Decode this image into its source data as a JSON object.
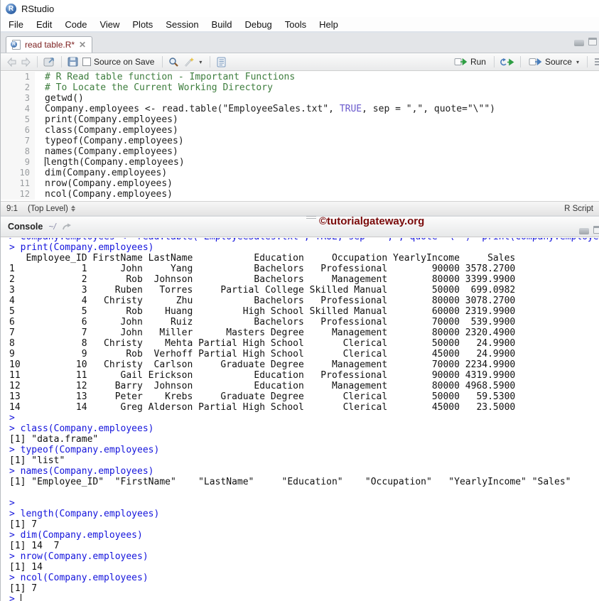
{
  "window": {
    "title": "RStudio"
  },
  "menu": [
    "File",
    "Edit",
    "Code",
    "View",
    "Plots",
    "Session",
    "Build",
    "Debug",
    "Tools",
    "Help"
  ],
  "editor": {
    "tab_label": "read table.R*",
    "toolbar": {
      "source_on_save": "Source on Save",
      "run": "Run",
      "source": "Source"
    },
    "status": {
      "cursor_position": "9:1",
      "scope": "(Top Level)",
      "file_type": "R Script"
    },
    "lines": [
      {
        "n": "1",
        "segs": [
          [
            "comment",
            "# R Read table function - Important Functions"
          ]
        ]
      },
      {
        "n": "2",
        "segs": [
          [
            "comment",
            "# To Locate the Current Working Directory"
          ]
        ]
      },
      {
        "n": "3",
        "segs": [
          [
            "code",
            "getwd()"
          ]
        ]
      },
      {
        "n": "4",
        "segs": [
          [
            "code",
            "Company.employees <- read.table(\"EmployeeSales.txt\", "
          ],
          [
            "keyword",
            "TRUE"
          ],
          [
            "code",
            ", sep = \",\", quote=\"\\\"\")"
          ]
        ]
      },
      {
        "n": "5",
        "segs": [
          [
            "code",
            "print(Company.employees)"
          ]
        ]
      },
      {
        "n": "6",
        "segs": [
          [
            "code",
            "class(Company.employees)"
          ]
        ]
      },
      {
        "n": "7",
        "segs": [
          [
            "code",
            "typeof(Company.employees)"
          ]
        ]
      },
      {
        "n": "8",
        "segs": [
          [
            "code",
            "names(Company.employees)"
          ]
        ]
      },
      {
        "n": "9",
        "segs": [
          [
            "cursor",
            ""
          ],
          [
            "code",
            "length(Company.employees)"
          ]
        ]
      },
      {
        "n": "10",
        "segs": [
          [
            "code",
            "dim(Company.employees)"
          ]
        ]
      },
      {
        "n": "11",
        "segs": [
          [
            "code",
            "nrow(Company.employees)"
          ]
        ]
      },
      {
        "n": "12",
        "segs": [
          [
            "code",
            "ncol(Company.employees)"
          ]
        ]
      }
    ]
  },
  "console": {
    "title": "Console",
    "path": "~/",
    "lines": [
      [
        "clip",
        "> Company.employees <- read.table(\"EmployeeSales.txt\", TRUE, sep = \",\", quote=\"\\\"\")  print(Company.employees)  class(Company.employees)  typeof(Company.employees)"
      ],
      [
        "in",
        "> print(Company.employees)"
      ],
      [
        "out",
        "   Employee_ID FirstName LastName           Education     Occupation YearlyIncome     Sales"
      ],
      [
        "out",
        "1            1      John     Yang           Bachelors   Professional        90000 3578.2700"
      ],
      [
        "out",
        "2            2       Rob  Johnson           Bachelors     Management        80000 3399.9900"
      ],
      [
        "out",
        "3            3     Ruben   Torres     Partial College Skilled Manual        50000  699.0982"
      ],
      [
        "out",
        "4            4   Christy      Zhu           Bachelors   Professional        80000 3078.2700"
      ],
      [
        "out",
        "5            5       Rob    Huang         High School Skilled Manual        60000 2319.9900"
      ],
      [
        "out",
        "6            6      John     Ruiz           Bachelors   Professional        70000  539.9900"
      ],
      [
        "out",
        "7            7      John   Miller      Masters Degree     Management        80000 2320.4900"
      ],
      [
        "out",
        "8            8   Christy    Mehta Partial High School       Clerical        50000   24.9900"
      ],
      [
        "out",
        "9            9       Rob  Verhoff Partial High School       Clerical        45000   24.9900"
      ],
      [
        "out",
        "10          10   Christy  Carlson     Graduate Degree     Management        70000 2234.9900"
      ],
      [
        "out",
        "11          11      Gail Erickson           Education   Professional        90000 4319.9900"
      ],
      [
        "out",
        "12          12     Barry  Johnson           Education     Management        80000 4968.5900"
      ],
      [
        "out",
        "13          13     Peter    Krebs     Graduate Degree       Clerical        50000   59.5300"
      ],
      [
        "out",
        "14          14      Greg Alderson Partial High School       Clerical        45000   23.5000"
      ],
      [
        "in",
        "> "
      ],
      [
        "in",
        "> class(Company.employees)"
      ],
      [
        "out",
        "[1] \"data.frame\""
      ],
      [
        "in",
        "> typeof(Company.employees)"
      ],
      [
        "out",
        "[1] \"list\""
      ],
      [
        "in",
        "> names(Company.employees)"
      ],
      [
        "out",
        "[1] \"Employee_ID\"  \"FirstName\"    \"LastName\"     \"Education\"    \"Occupation\"   \"YearlyIncome\" \"Sales\""
      ],
      [
        "out",
        ""
      ],
      [
        "in",
        "> "
      ],
      [
        "in",
        "> length(Company.employees)"
      ],
      [
        "out",
        "[1] 7"
      ],
      [
        "in",
        "> dim(Company.employees)"
      ],
      [
        "out",
        "[1] 14  7"
      ],
      [
        "in",
        "> nrow(Company.employees)"
      ],
      [
        "out",
        "[1] 14"
      ],
      [
        "in",
        "> ncol(Company.employees)"
      ],
      [
        "out",
        "[1] 7"
      ],
      [
        "prompt",
        "> "
      ]
    ]
  },
  "watermark": "©tutorialgateway.org",
  "colors": {
    "comment": "#3d7d3d",
    "keyword": "#6a5acd",
    "console_input": "#1414dc",
    "tab_label": "#7c2020",
    "watermark": "#7a0a0a",
    "run_arrow": "#2f9e44",
    "source_arrow": "#4a7ebb"
  }
}
